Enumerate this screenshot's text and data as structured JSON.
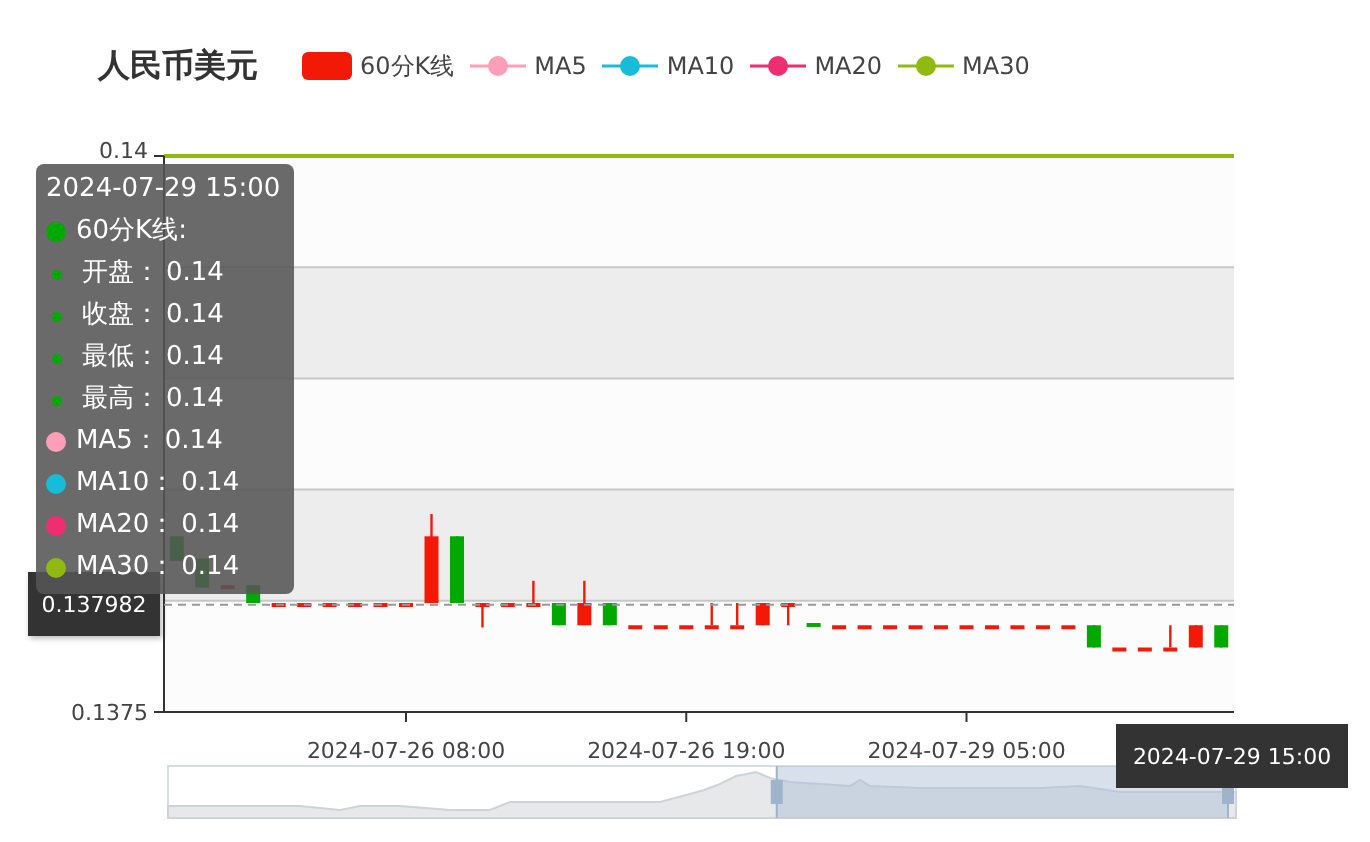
{
  "title": "人民币美元",
  "legend": [
    {
      "kind": "candle",
      "label": "60分K线",
      "color": "#f21a07"
    },
    {
      "kind": "line",
      "label": "MA5",
      "color": "#ff9eb7"
    },
    {
      "kind": "line",
      "label": "MA10",
      "color": "#19bcd8"
    },
    {
      "kind": "line",
      "label": "MA20",
      "color": "#ee2e70"
    },
    {
      "kind": "line",
      "label": "MA30",
      "color": "#8fba11"
    }
  ],
  "y_axis_labels": [
    "0.14",
    "0.1375"
  ],
  "x_axis_labels": [
    "2024-07-26 08:00",
    "2024-07-26 19:00",
    "2024-07-29 05:00"
  ],
  "crosshair": {
    "value_label": "0.137982",
    "time_label": "2024-07-29 15:00"
  },
  "tooltip": {
    "title": "2024-07-29 15:00",
    "rows": [
      {
        "kind": "series",
        "label": "60分K线:",
        "color": "#00aa00"
      },
      {
        "kind": "field",
        "label": "开盘：",
        "value": "0.14",
        "color": "#00aa00"
      },
      {
        "kind": "field",
        "label": "收盘：",
        "value": "0.14",
        "color": "#00aa00"
      },
      {
        "kind": "field",
        "label": "最低：",
        "value": "0.14",
        "color": "#00aa00"
      },
      {
        "kind": "field",
        "label": "最高：",
        "value": "0.14",
        "color": "#00aa00"
      },
      {
        "kind": "series",
        "label": "MA5：",
        "value": "0.14",
        "color": "#ff9eb7"
      },
      {
        "kind": "series",
        "label": "MA10：",
        "value": "0.14",
        "color": "#19bcd8"
      },
      {
        "kind": "series",
        "label": "MA20：",
        "value": "0.14",
        "color": "#ee2e70"
      },
      {
        "kind": "series",
        "label": "MA30：",
        "value": "0.14",
        "color": "#8fba11"
      }
    ]
  }
}
